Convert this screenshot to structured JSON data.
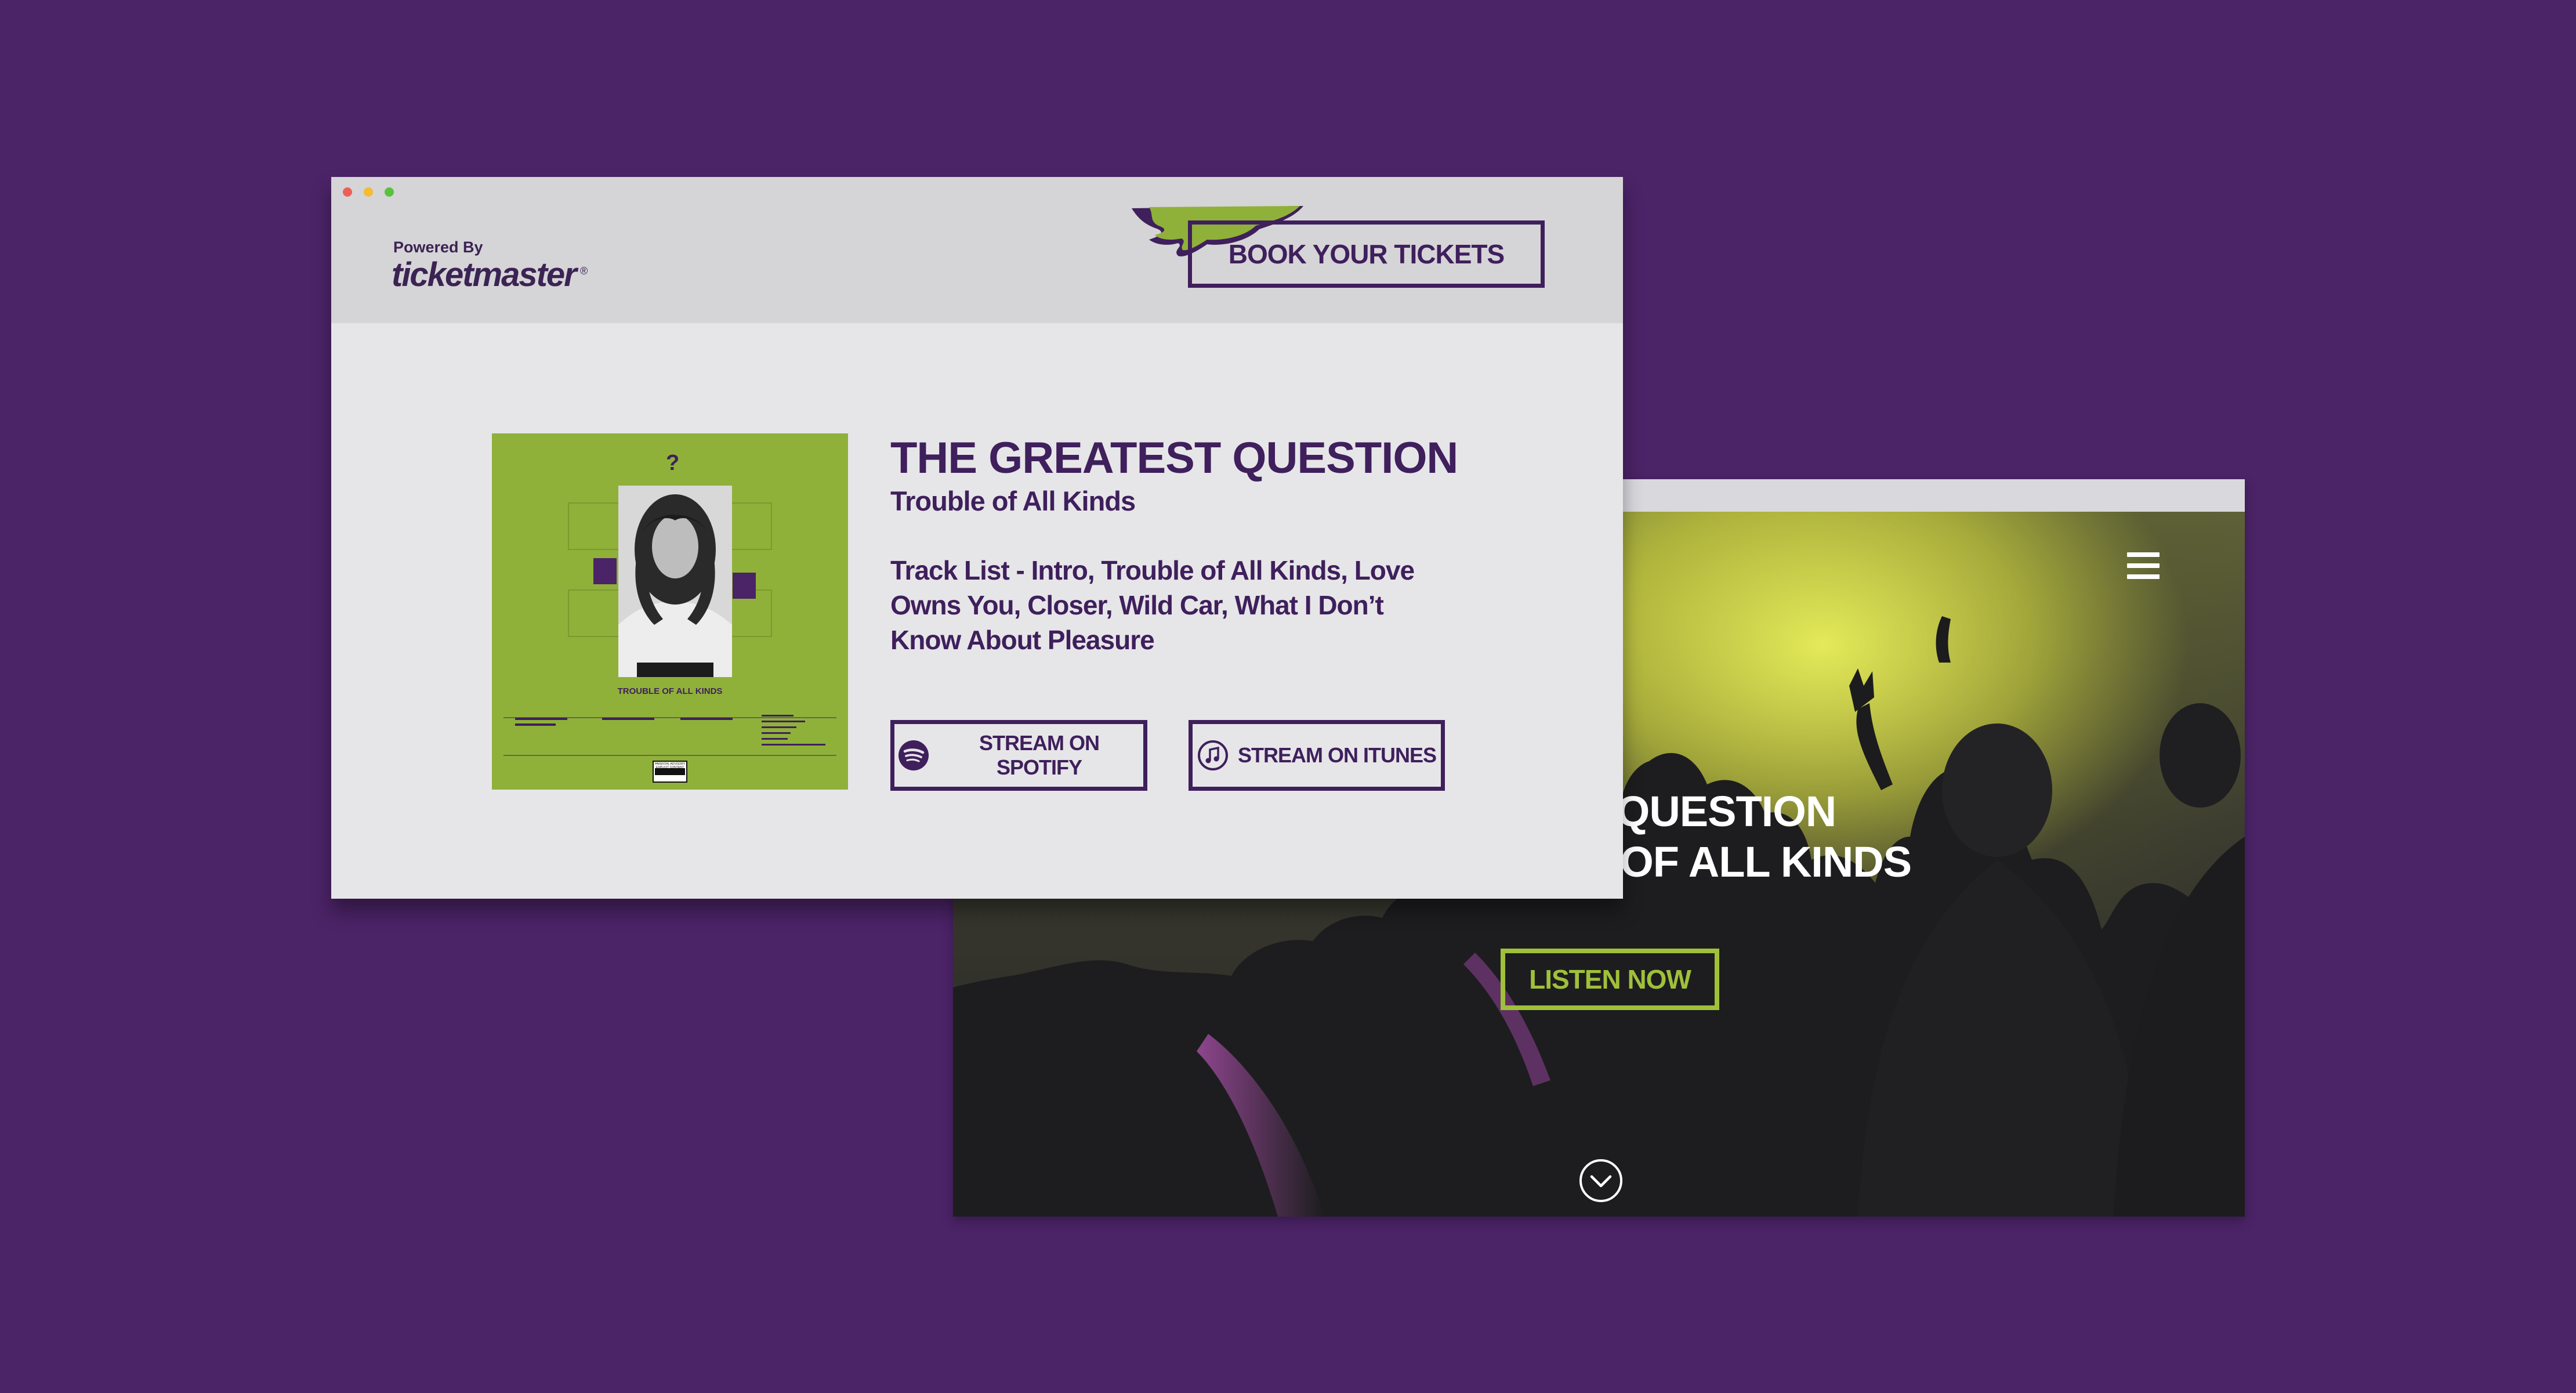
{
  "hero": {
    "title_line_1": "T QUESTION",
    "title_line_2": "TROUBLE OF ALL KINDS",
    "cta_label": "LISTEN NOW",
    "menu_icon": "hamburger-icon",
    "scroll_icon": "chevron-down-circle-icon"
  },
  "header": {
    "powered_by": "Powered By",
    "logo_text": "ticketmaster",
    "logo_mark": "®",
    "book_label": "BOOK YOUR TICKETS"
  },
  "album": {
    "title": "THE GREATEST QUESTION",
    "subtitle": "Trouble of All Kinds",
    "track_list": "Track List - Intro, Trouble of All Kinds, Love Owns You, Closer, Wild Car, What I Don’t Know About Pleasure",
    "cover": {
      "question_mark": "?",
      "cover_title": "TROUBLE OF ALL KINDS",
      "advisory": "PARENTAL ADVISORY EXPLICIT CONTENT"
    }
  },
  "streaming": {
    "spotify_label": "STREAM ON SPOTIFY",
    "itunes_label": "STREAM ON ITUNES"
  },
  "colors": {
    "background": "#4b2367",
    "brand_purple": "#3f1f5c",
    "brand_green": "#8fb13a",
    "cta_green": "#a0c03a",
    "panel_gray": "#e6e6e8"
  }
}
